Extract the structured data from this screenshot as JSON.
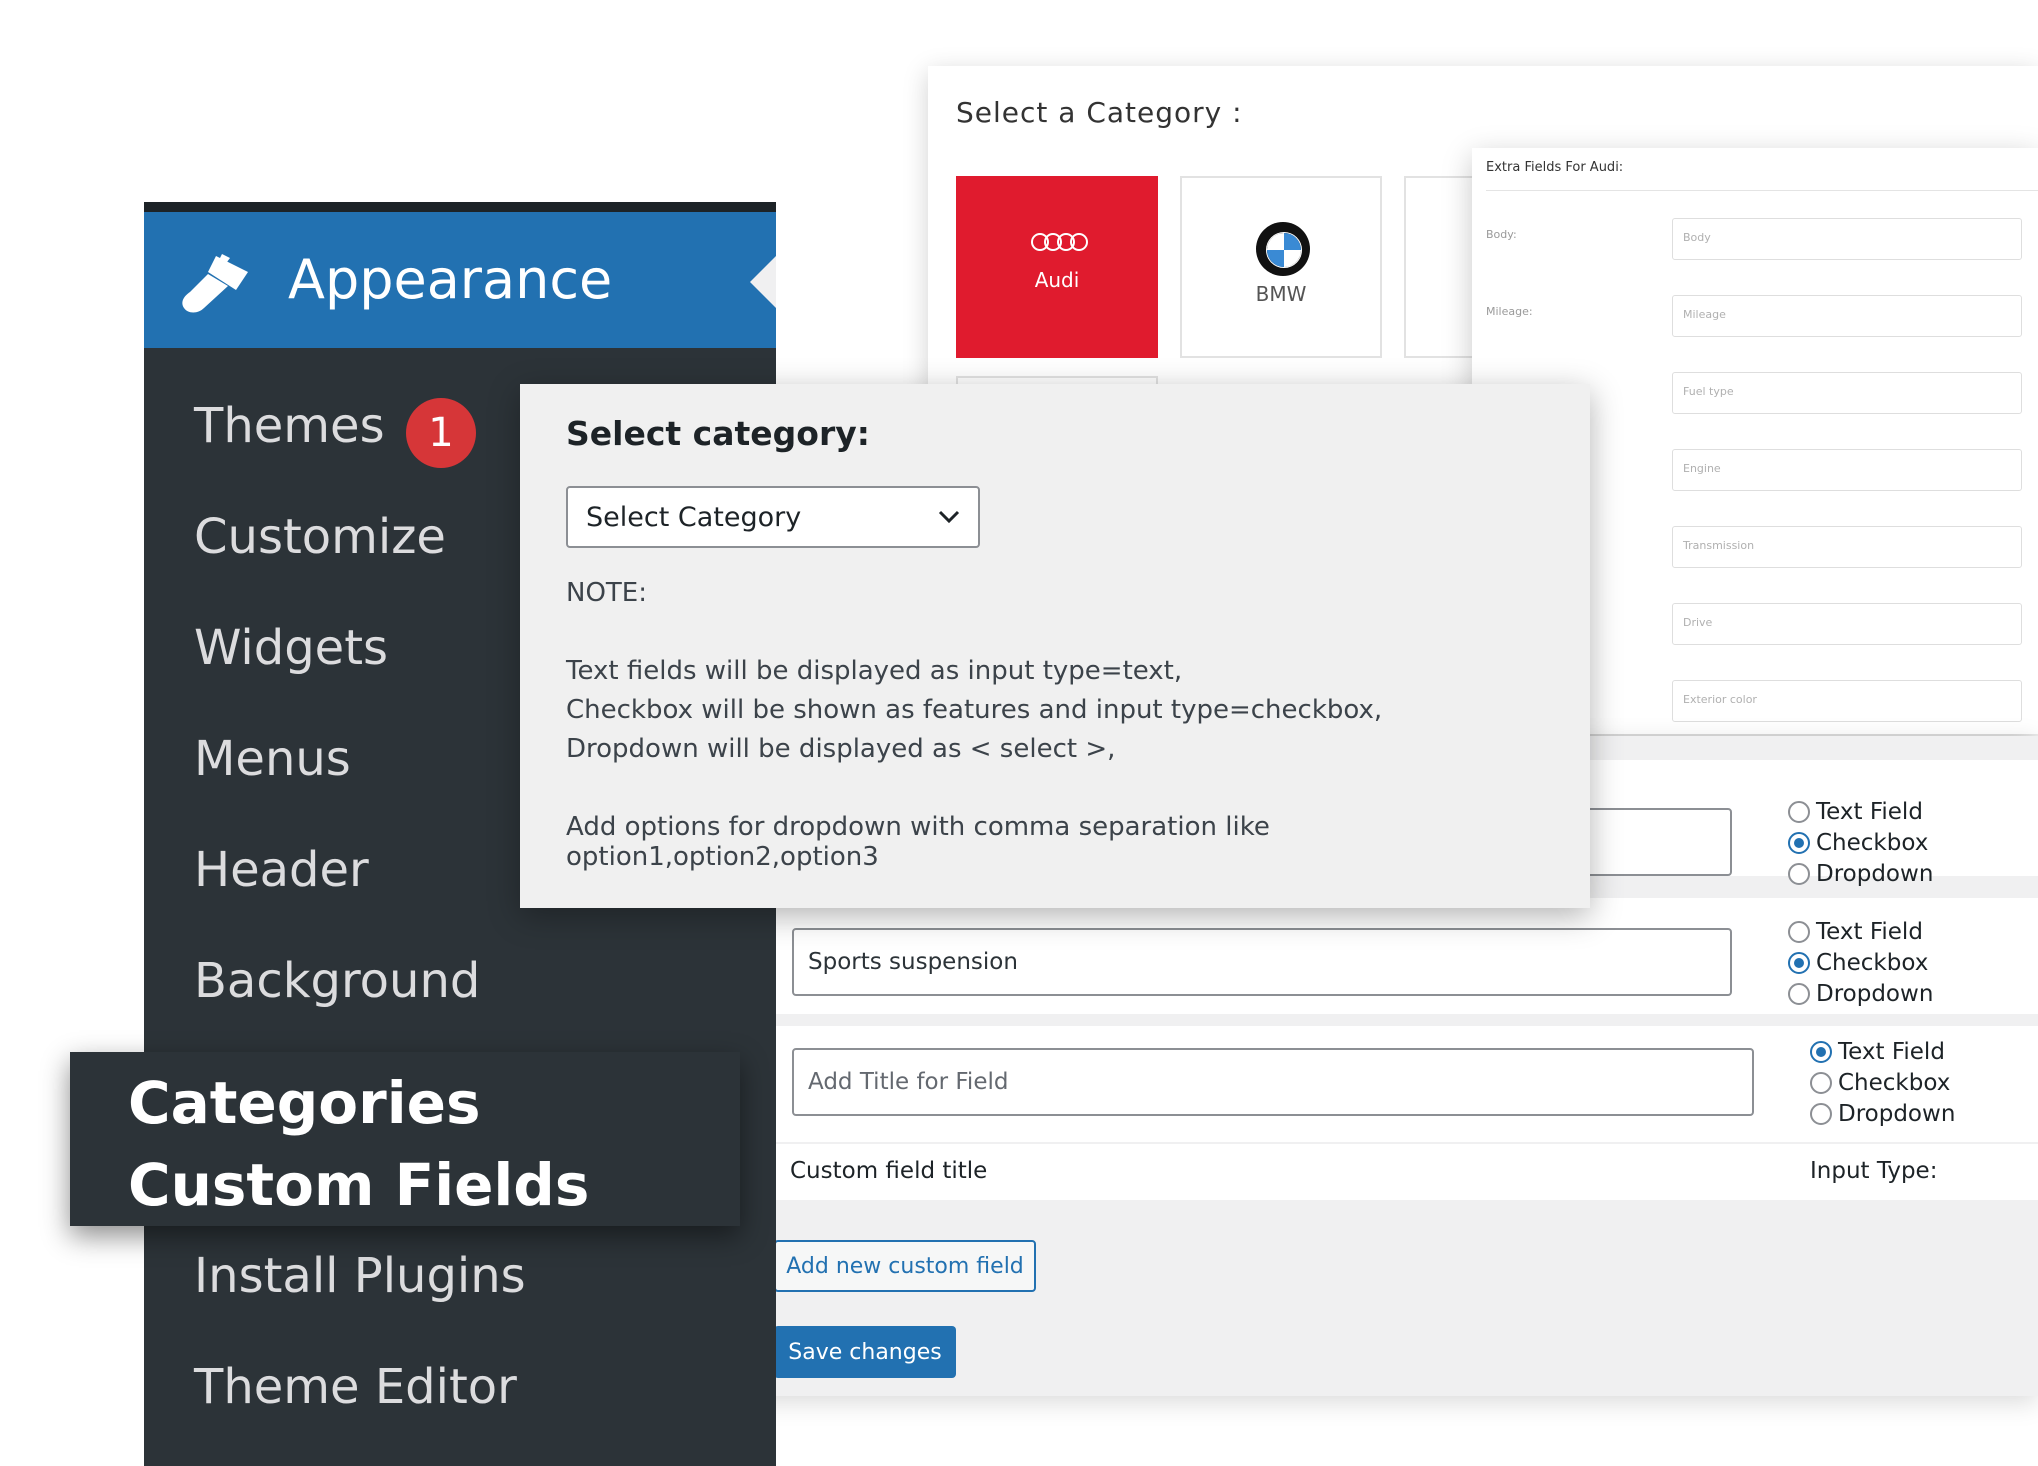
{
  "category_picker": {
    "title": "Select a Category :",
    "tiles": [
      {
        "label": "Audi",
        "active": true,
        "logo": "audi-rings-icon"
      },
      {
        "label": "BMW",
        "active": false,
        "logo": "bmw-logo-icon"
      }
    ]
  },
  "extra_fields": {
    "header": "Extra Fields For Audi:",
    "rows": [
      {
        "label": "Body:",
        "placeholder": "Body"
      },
      {
        "label": "Mileage:",
        "placeholder": "Mileage"
      },
      {
        "label": "",
        "placeholder": "Fuel type"
      },
      {
        "label": "",
        "placeholder": "Engine"
      },
      {
        "label": "",
        "placeholder": "Transmission"
      },
      {
        "label": "",
        "placeholder": "Drive"
      },
      {
        "label": "",
        "placeholder": "Exterior color"
      }
    ]
  },
  "sidebar": {
    "section": "Appearance",
    "items": [
      {
        "label": "Themes",
        "badge": "1"
      },
      {
        "label": "Customize"
      },
      {
        "label": "Widgets"
      },
      {
        "label": "Menus"
      },
      {
        "label": "Header"
      },
      {
        "label": "Background"
      },
      {
        "label": "Categories Custom Fields",
        "current": true
      },
      {
        "label": "Install Plugins"
      },
      {
        "label": "Theme Editor"
      }
    ]
  },
  "popup": {
    "heading": "Select category:",
    "select_value": "Select Category",
    "note_title": "NOTE:",
    "lines": [
      "Text fields will be displayed as input type=text,",
      "Checkbox will be shown as features and input type=checkbox,",
      "Dropdown will be displayed as < select >,",
      "Add options for dropdown with comma separation like option1,option2,option3"
    ]
  },
  "fields": {
    "input_types": [
      "Text Field",
      "Checkbox",
      "Dropdown"
    ],
    "rows": [
      {
        "value": "",
        "placeholder": "",
        "selected": "Checkbox"
      },
      {
        "value": "Sports suspension",
        "placeholder": "",
        "selected": "Checkbox"
      },
      {
        "value": "",
        "placeholder": "Add Title for Field",
        "selected": "Text Field"
      }
    ],
    "footer_title_label": "Custom field title",
    "footer_type_label": "Input Type:",
    "add_button": "Add new custom field",
    "save_button": "Save changes"
  },
  "colors": {
    "wp_blue": "#2271b1",
    "sidebar_bg": "#2c3338",
    "audi_red": "#e01b2e",
    "badge_red": "#d63638"
  }
}
